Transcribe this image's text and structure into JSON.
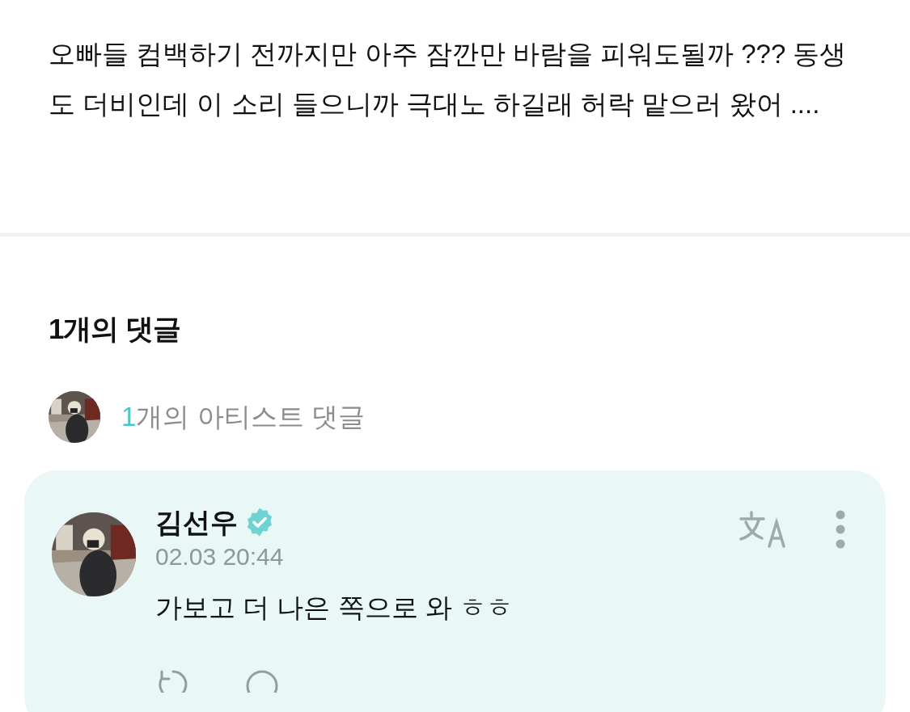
{
  "post": {
    "text": "오빠들 컴백하기 전까지만 아주 잠깐만 바람을 피워도될까 ??? 동생도 더비인데 이 소리 들으니까 극대노 하길래 허락 맡으러 왔어 ...."
  },
  "comments_header": {
    "title": "1개의 댓글"
  },
  "artist_summary": {
    "count": "1",
    "label": "개의 아티스트 댓글"
  },
  "comments": [
    {
      "author": "김선우",
      "verified": true,
      "time": "02.03 20:44",
      "text": "가보고 더 나은 쪽으로 와 ㅎㅎ"
    }
  ]
}
